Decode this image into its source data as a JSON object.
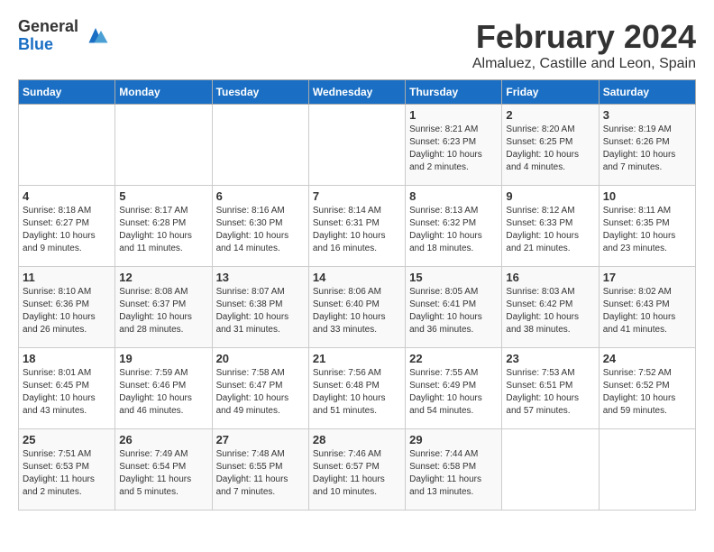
{
  "logo": {
    "general": "General",
    "blue": "Blue"
  },
  "header": {
    "month": "February 2024",
    "location": "Almaluez, Castille and Leon, Spain"
  },
  "weekdays": [
    "Sunday",
    "Monday",
    "Tuesday",
    "Wednesday",
    "Thursday",
    "Friday",
    "Saturday"
  ],
  "weeks": [
    [
      {
        "day": "",
        "info": ""
      },
      {
        "day": "",
        "info": ""
      },
      {
        "day": "",
        "info": ""
      },
      {
        "day": "",
        "info": ""
      },
      {
        "day": "1",
        "info": "Sunrise: 8:21 AM\nSunset: 6:23 PM\nDaylight: 10 hours\nand 2 minutes."
      },
      {
        "day": "2",
        "info": "Sunrise: 8:20 AM\nSunset: 6:25 PM\nDaylight: 10 hours\nand 4 minutes."
      },
      {
        "day": "3",
        "info": "Sunrise: 8:19 AM\nSunset: 6:26 PM\nDaylight: 10 hours\nand 7 minutes."
      }
    ],
    [
      {
        "day": "4",
        "info": "Sunrise: 8:18 AM\nSunset: 6:27 PM\nDaylight: 10 hours\nand 9 minutes."
      },
      {
        "day": "5",
        "info": "Sunrise: 8:17 AM\nSunset: 6:28 PM\nDaylight: 10 hours\nand 11 minutes."
      },
      {
        "day": "6",
        "info": "Sunrise: 8:16 AM\nSunset: 6:30 PM\nDaylight: 10 hours\nand 14 minutes."
      },
      {
        "day": "7",
        "info": "Sunrise: 8:14 AM\nSunset: 6:31 PM\nDaylight: 10 hours\nand 16 minutes."
      },
      {
        "day": "8",
        "info": "Sunrise: 8:13 AM\nSunset: 6:32 PM\nDaylight: 10 hours\nand 18 minutes."
      },
      {
        "day": "9",
        "info": "Sunrise: 8:12 AM\nSunset: 6:33 PM\nDaylight: 10 hours\nand 21 minutes."
      },
      {
        "day": "10",
        "info": "Sunrise: 8:11 AM\nSunset: 6:35 PM\nDaylight: 10 hours\nand 23 minutes."
      }
    ],
    [
      {
        "day": "11",
        "info": "Sunrise: 8:10 AM\nSunset: 6:36 PM\nDaylight: 10 hours\nand 26 minutes."
      },
      {
        "day": "12",
        "info": "Sunrise: 8:08 AM\nSunset: 6:37 PM\nDaylight: 10 hours\nand 28 minutes."
      },
      {
        "day": "13",
        "info": "Sunrise: 8:07 AM\nSunset: 6:38 PM\nDaylight: 10 hours\nand 31 minutes."
      },
      {
        "day": "14",
        "info": "Sunrise: 8:06 AM\nSunset: 6:40 PM\nDaylight: 10 hours\nand 33 minutes."
      },
      {
        "day": "15",
        "info": "Sunrise: 8:05 AM\nSunset: 6:41 PM\nDaylight: 10 hours\nand 36 minutes."
      },
      {
        "day": "16",
        "info": "Sunrise: 8:03 AM\nSunset: 6:42 PM\nDaylight: 10 hours\nand 38 minutes."
      },
      {
        "day": "17",
        "info": "Sunrise: 8:02 AM\nSunset: 6:43 PM\nDaylight: 10 hours\nand 41 minutes."
      }
    ],
    [
      {
        "day": "18",
        "info": "Sunrise: 8:01 AM\nSunset: 6:45 PM\nDaylight: 10 hours\nand 43 minutes."
      },
      {
        "day": "19",
        "info": "Sunrise: 7:59 AM\nSunset: 6:46 PM\nDaylight: 10 hours\nand 46 minutes."
      },
      {
        "day": "20",
        "info": "Sunrise: 7:58 AM\nSunset: 6:47 PM\nDaylight: 10 hours\nand 49 minutes."
      },
      {
        "day": "21",
        "info": "Sunrise: 7:56 AM\nSunset: 6:48 PM\nDaylight: 10 hours\nand 51 minutes."
      },
      {
        "day": "22",
        "info": "Sunrise: 7:55 AM\nSunset: 6:49 PM\nDaylight: 10 hours\nand 54 minutes."
      },
      {
        "day": "23",
        "info": "Sunrise: 7:53 AM\nSunset: 6:51 PM\nDaylight: 10 hours\nand 57 minutes."
      },
      {
        "day": "24",
        "info": "Sunrise: 7:52 AM\nSunset: 6:52 PM\nDaylight: 10 hours\nand 59 minutes."
      }
    ],
    [
      {
        "day": "25",
        "info": "Sunrise: 7:51 AM\nSunset: 6:53 PM\nDaylight: 11 hours\nand 2 minutes."
      },
      {
        "day": "26",
        "info": "Sunrise: 7:49 AM\nSunset: 6:54 PM\nDaylight: 11 hours\nand 5 minutes."
      },
      {
        "day": "27",
        "info": "Sunrise: 7:48 AM\nSunset: 6:55 PM\nDaylight: 11 hours\nand 7 minutes."
      },
      {
        "day": "28",
        "info": "Sunrise: 7:46 AM\nSunset: 6:57 PM\nDaylight: 11 hours\nand 10 minutes."
      },
      {
        "day": "29",
        "info": "Sunrise: 7:44 AM\nSunset: 6:58 PM\nDaylight: 11 hours\nand 13 minutes."
      },
      {
        "day": "",
        "info": ""
      },
      {
        "day": "",
        "info": ""
      }
    ]
  ]
}
